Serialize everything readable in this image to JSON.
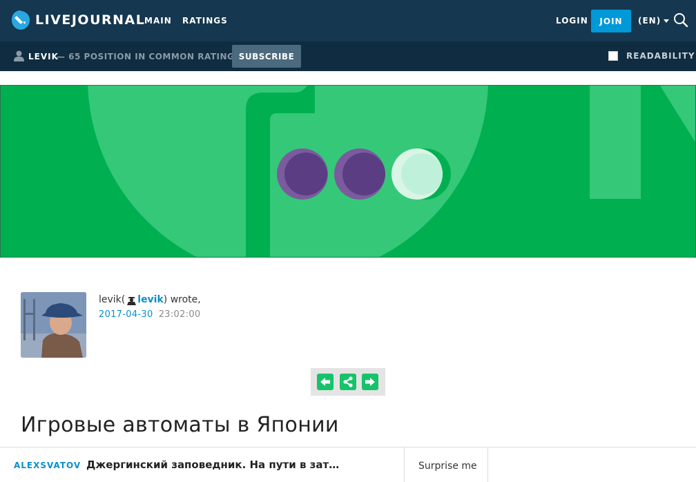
{
  "header": {
    "logo_text": "LIVEJOURNAL",
    "nav": [
      {
        "label": "MAIN"
      },
      {
        "label": "RATINGS"
      }
    ],
    "login_label": "LOGIN",
    "join_label": "JOIN",
    "language_label": "(EN)",
    "search_icon": "search-icon"
  },
  "subbar": {
    "username": "LEVIK",
    "rank_text": "— 65 POSITION IN COMMON RATING",
    "subscribe_label": "SUBSCRIBE",
    "readability_label": "READABILITY",
    "readability_checked": false
  },
  "post": {
    "author_name": "levik",
    "open_paren": "(",
    "author_link": "levik",
    "wrote_text": ") wrote,",
    "date": "2017-04-30",
    "time": "23:02:00",
    "title": "Игровые автоматы в Японии"
  },
  "post_nav": {
    "prev_icon": "arrow-left-icon",
    "share_icon": "share-icon",
    "next_icon": "arrow-right-icon"
  },
  "bottombar": {
    "author": "ALEXSVATOV",
    "title": "Джергинский заповедник. На пути в затерянный мир",
    "surprise_label": "Surprise me"
  },
  "colors": {
    "header_bg": "#15374f",
    "subbar_bg": "#0f2c40",
    "accent_blue": "#0099d8",
    "banner_green": "#00b050",
    "banner_light_green": "#35c878",
    "nav_green": "#16c36a"
  }
}
